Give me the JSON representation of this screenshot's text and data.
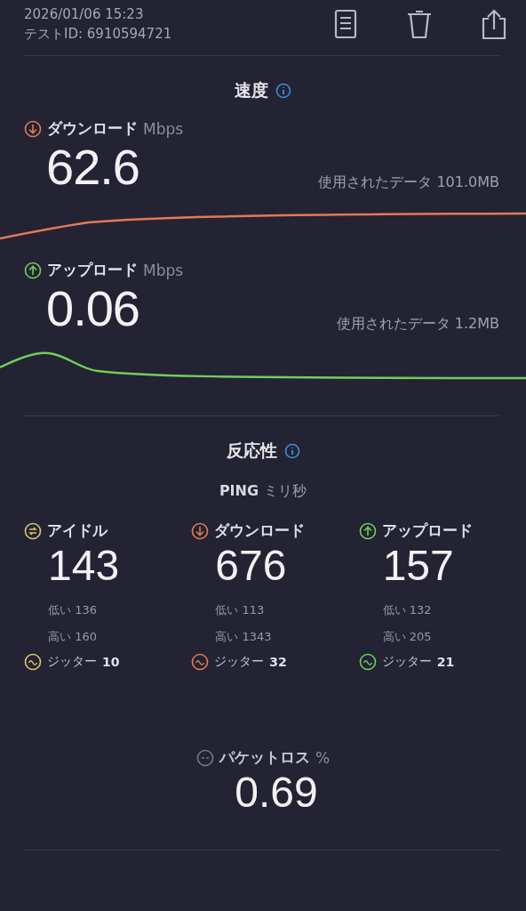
{
  "header": {
    "datetime": "2026/01/06 15:23",
    "test_id": "テストID: 6910594721"
  },
  "speed": {
    "title": "速度",
    "metrics": [
      {
        "kind": "download",
        "label": "ダウンロード",
        "unit": "Mbps",
        "value": "62.6",
        "data_used": "使用されたデータ 101.0MB",
        "color": "#e07a55"
      },
      {
        "kind": "upload",
        "label": "アップロード",
        "unit": "Mbps",
        "value": "0.06",
        "data_used": "使用されたデータ 1.2MB",
        "color": "#6fcf5a"
      }
    ]
  },
  "responsiveness": {
    "title": "反応性",
    "ping_label": "PING",
    "ping_unit": "ミリ秒",
    "columns": [
      {
        "kind": "idle",
        "label": "アイドル",
        "value": "143",
        "low": "低い 136",
        "high": "高い 160",
        "jitter_label": "ジッター",
        "jitter": "10",
        "color": "#d9c86a"
      },
      {
        "kind": "download",
        "label": "ダウンロード",
        "value": "676",
        "low": "低い 113",
        "high": "高い 1343",
        "jitter_label": "ジッター",
        "jitter": "32",
        "color": "#e07a55"
      },
      {
        "kind": "upload",
        "label": "アップロード",
        "value": "157",
        "low": "低い 132",
        "high": "高い 205",
        "jitter_label": "ジッター",
        "jitter": "21",
        "color": "#6fcf5a"
      }
    ]
  },
  "packet_loss": {
    "label": "パケットロス",
    "unit": "%",
    "value": "0.69"
  }
}
